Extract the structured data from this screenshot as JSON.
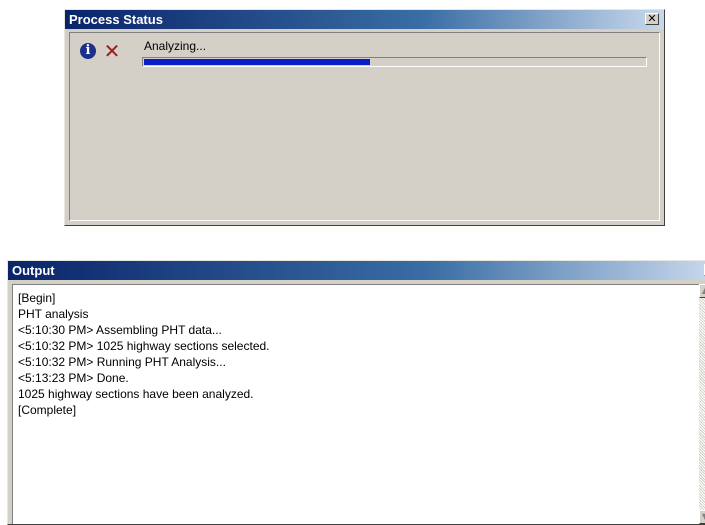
{
  "process_status": {
    "title": "Process Status",
    "close_glyph": "✕",
    "info_glyph": "i",
    "cancel_glyph": "✕",
    "status_text": "Analyzing...",
    "progress_fraction": 0.45,
    "progress_color": "#0a1ec8",
    "icons": [
      "info-icon",
      "cancel-icon",
      "close-icon"
    ]
  },
  "output": {
    "title": "Output",
    "close_glyph": "✕",
    "lines": [
      "[Begin]",
      "PHT analysis",
      "<5:10:30 PM> Assembling PHT data...",
      "<5:10:32 PM> 1025 highway sections selected.",
      "<5:10:32 PM> Running PHT Analysis...",
      "<5:13:23 PM> Done.",
      "1025 highway sections have been analyzed.",
      "[Complete]"
    ],
    "scroll_up_glyph": "▲",
    "scroll_down_glyph": "▼"
  },
  "colors": {
    "titlebar_start": "#0a246a",
    "titlebar_end": "#c8d8ec",
    "window_bg": "#d4d0c8"
  }
}
